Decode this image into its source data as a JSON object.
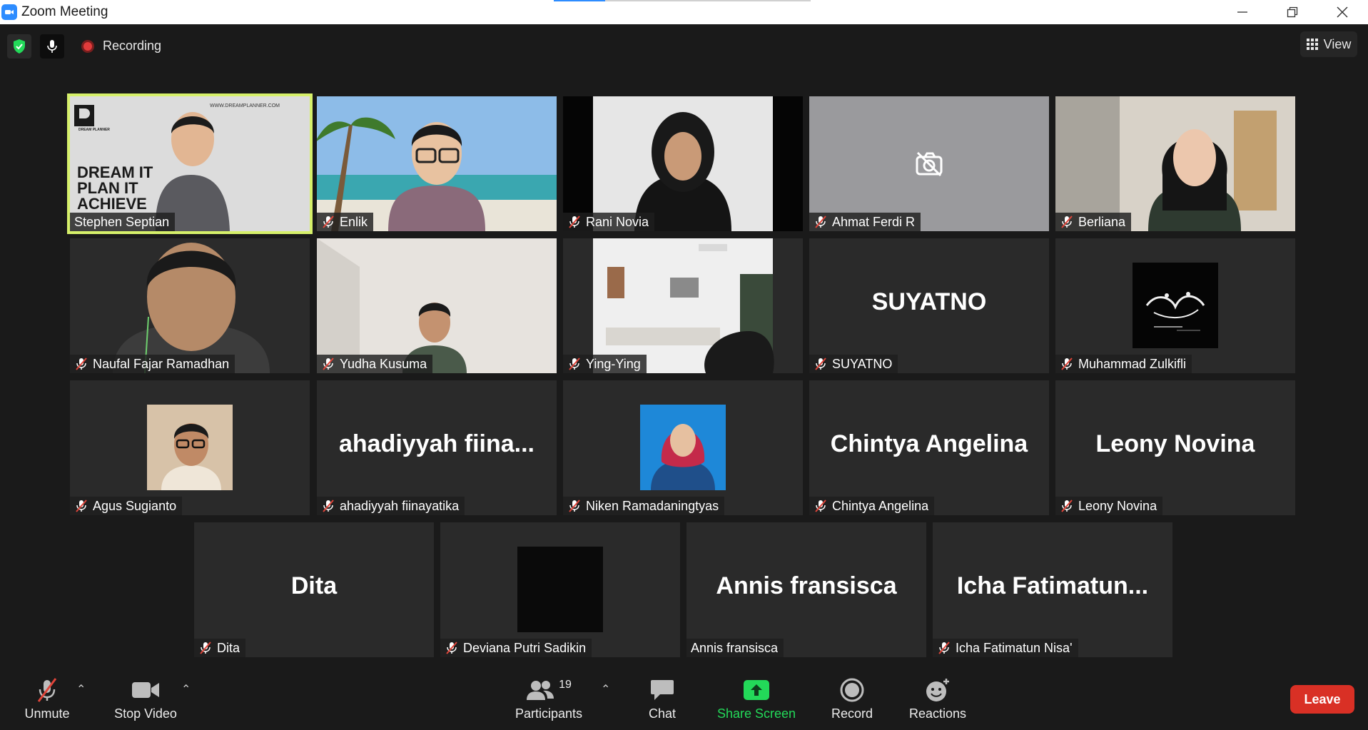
{
  "window": {
    "title": "Zoom Meeting"
  },
  "topbar": {
    "recording_label": "Recording",
    "view_label": "View"
  },
  "tiles": [
    {
      "name": "Stephen Septian",
      "muted": false,
      "active": true,
      "display": "video"
    },
    {
      "name": "Enlik",
      "muted": true,
      "display": "video"
    },
    {
      "name": "Rani Novia",
      "muted": true,
      "display": "video"
    },
    {
      "name": "Ahmat Ferdi R",
      "muted": true,
      "display": "camera-off"
    },
    {
      "name": "Berliana",
      "muted": true,
      "display": "video"
    },
    {
      "name": "Naufal Fajar Ramadhan",
      "muted": true,
      "display": "video"
    },
    {
      "name": "Yudha Kusuma",
      "muted": true,
      "display": "video"
    },
    {
      "name": "Ying-Ying",
      "muted": true,
      "display": "video"
    },
    {
      "name": "SUYATNO",
      "muted": true,
      "display": "text",
      "big": "SUYATNO"
    },
    {
      "name": "Muhammad Zulkifli",
      "muted": true,
      "display": "avatar"
    },
    {
      "name": "Agus Sugianto",
      "muted": true,
      "display": "avatar"
    },
    {
      "name": "ahadiyyah fiinayatika",
      "muted": true,
      "display": "text",
      "big": "ahadiyyah  fiina..."
    },
    {
      "name": "Niken Ramadaningtyas",
      "muted": true,
      "display": "avatar"
    },
    {
      "name": "Chintya Angelina",
      "muted": true,
      "display": "text",
      "big": "Chintya Angelina"
    },
    {
      "name": "Leony Novina",
      "muted": true,
      "display": "text",
      "big": "Leony Novina"
    },
    {
      "name": "Dita",
      "muted": true,
      "display": "text",
      "big": "Dita"
    },
    {
      "name": "Deviana Putri Sadikin",
      "muted": true,
      "display": "avatar"
    },
    {
      "name": "Annis fransisca",
      "muted": false,
      "display": "text",
      "big": "Annis fransisca"
    },
    {
      "name": "Icha Fatimatun Nisa'",
      "muted": true,
      "display": "text",
      "big": "Icha  Fatimatun..."
    }
  ],
  "overlay_text": {
    "brand_url": "WWW.DREAMPLANNER.COM",
    "brand_logo": "DREAM PLANNER",
    "brand_slogan": "DREAM IT\nPLAN IT\nACHIEVE"
  },
  "toolbar": {
    "unmute_label": "Unmute",
    "stop_video_label": "Stop Video",
    "participants_label": "Participants",
    "participants_count": "19",
    "chat_label": "Chat",
    "share_screen_label": "Share Screen",
    "record_label": "Record",
    "reactions_label": "Reactions",
    "leave_label": "Leave"
  },
  "colors": {
    "active_speaker": "#d6f06a",
    "share_green": "#23d959",
    "leave_red": "#d93025",
    "mute_red": "#e0453a"
  }
}
